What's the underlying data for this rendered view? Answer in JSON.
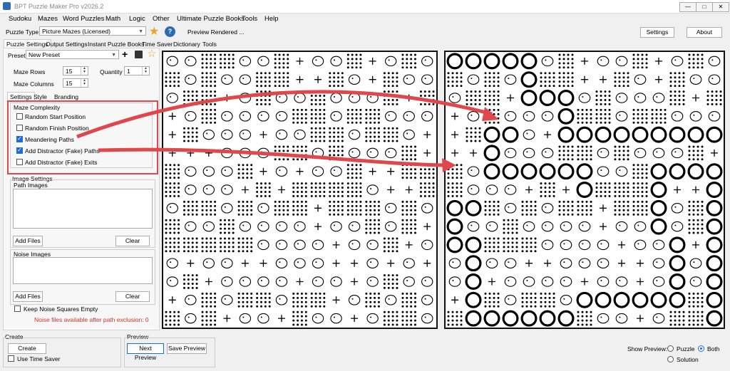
{
  "window": {
    "title": "BPT Puzzle Maker Pro v2026.2",
    "minimize": "—",
    "maximize": "□",
    "close": "✕"
  },
  "menu": [
    "Sudoku",
    "Mazes",
    "Word Puzzles",
    "Math",
    "Logic",
    "Other",
    "Ultimate Puzzle Books",
    "Tools",
    "Help"
  ],
  "toolbar": {
    "puzzle_type_label": "Puzzle Type",
    "puzzle_type_value": "Picture Mazes (Licensed)",
    "help_glyph": "?",
    "status": "Preview Rendered ...",
    "settings_label": "Settings",
    "about_label": "About"
  },
  "tabs": [
    "Puzzle Settings",
    "Output Settings",
    "Instant Puzzle Books",
    "Time Saver",
    "Dictionary",
    "Tools"
  ],
  "preset": {
    "label": "Preset",
    "value": "New Preset"
  },
  "maze_rows": {
    "label": "Maze Rows",
    "value": "15"
  },
  "quantity": {
    "label": "Quantity",
    "value": "1"
  },
  "maze_columns": {
    "label": "Maze Columns",
    "value": "15"
  },
  "subtabs": [
    "Settings",
    "Style",
    "Branding"
  ],
  "complexity": {
    "title": "Maze Complexity",
    "options": [
      {
        "label": "Random Start Position",
        "checked": false
      },
      {
        "label": "Random Finish Position",
        "checked": false
      },
      {
        "label": "Meandering Paths",
        "checked": true
      },
      {
        "label": "Add Distractor (Fake) Paths",
        "checked": true
      },
      {
        "label": "Add Distractor (Fake) Exits",
        "checked": false
      }
    ]
  },
  "image_settings": {
    "title": "Image Settings",
    "path_images": "Path Images",
    "noise_images": "Noise Images",
    "add_files": "Add Files",
    "clear": "Clear",
    "keep_noise": "Keep Noise Squares Empty",
    "noise_note": "Noise files available after path exclusion: 0"
  },
  "create": {
    "title": "Create",
    "button": "Create",
    "time_saver": "Use Time Saver"
  },
  "preview": {
    "title": "Preview",
    "next": "Next Preview",
    "save": "Save Preview"
  },
  "show_preview": {
    "label": "Show Preview:",
    "options": [
      "Puzzle",
      "Both",
      "Solution"
    ],
    "selected": "Both"
  },
  "colors": {
    "accent": "#1c6fd1",
    "annotation": "#e0474c",
    "star": "#e9a32a"
  },
  "icons": [
    "star-icon",
    "help-icon",
    "plus-icon",
    "save-icon",
    "star-outline-icon"
  ]
}
